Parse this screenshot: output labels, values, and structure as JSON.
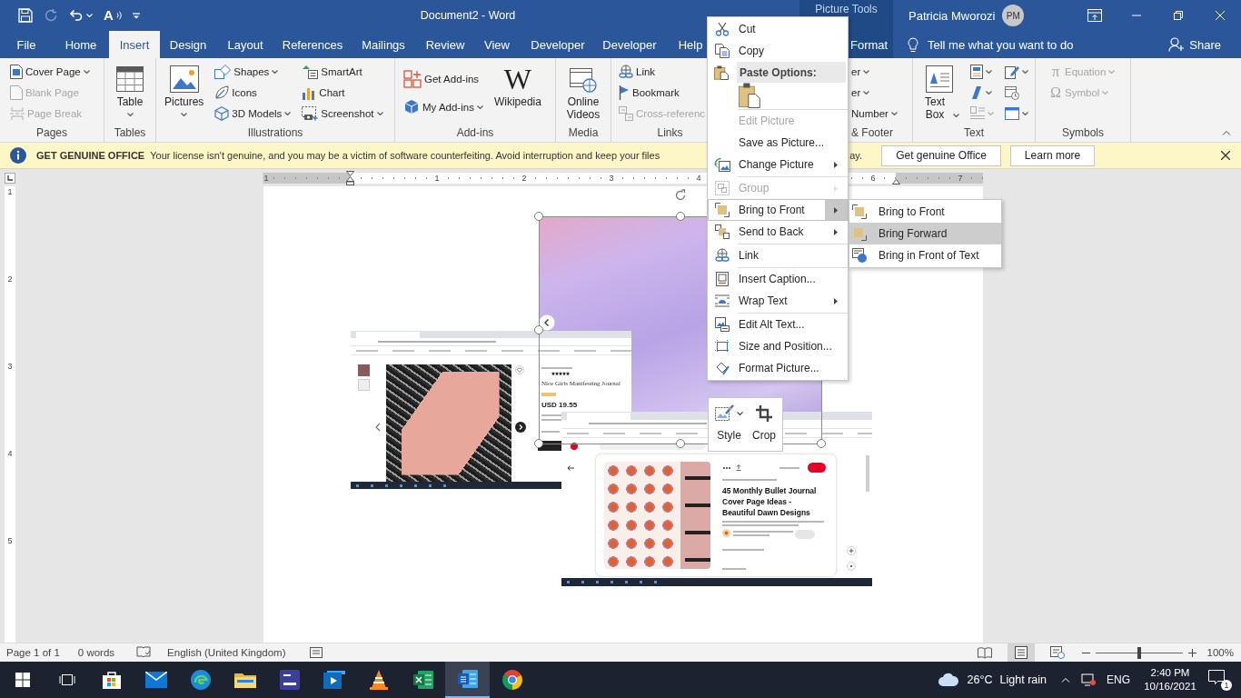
{
  "title_bar": {
    "quick_access": [
      {
        "kind": "save",
        "disabled": false,
        "dropdown": false
      },
      {
        "kind": "autosave",
        "disabled": true,
        "dropdown": false
      },
      {
        "kind": "undo",
        "disabled": false,
        "dropdown": true
      },
      {
        "kind": "read-aloud",
        "glyph": "A",
        "disabled": false,
        "dropdown": false
      },
      {
        "kind": "customize",
        "disabled": false,
        "dropdown": false
      }
    ],
    "title": "Document2 - Word",
    "contextual_header": "Picture Tools",
    "user": {
      "name": "Patricia Mworozi",
      "initials": "PM"
    }
  },
  "tabs": [
    {
      "label": "File",
      "selected": false,
      "contextual": false
    },
    {
      "label": "Home",
      "selected": false,
      "contextual": false
    },
    {
      "label": "Insert",
      "selected": true,
      "contextual": false
    },
    {
      "label": "Design",
      "selected": false,
      "contextual": false
    },
    {
      "label": "Layout",
      "selected": false,
      "contextual": false
    },
    {
      "label": "References",
      "selected": false,
      "contextual": false
    },
    {
      "label": "Mailings",
      "selected": false,
      "contextual": false
    },
    {
      "label": "Review",
      "selected": false,
      "contextual": false
    },
    {
      "label": "View",
      "selected": false,
      "contextual": false
    },
    {
      "label": "Developer",
      "selected": false,
      "contextual": false
    },
    {
      "label": "Developer",
      "selected": false,
      "contextual": false
    },
    {
      "label": "Help",
      "selected": false,
      "contextual": false
    },
    {
      "label": "Format",
      "selected": false,
      "contextual": true
    }
  ],
  "tell_me": {
    "placeholder": "Tell me what you want to do"
  },
  "share": {
    "label": "Share"
  },
  "ribbon": {
    "groups": [
      {
        "label": "Pages",
        "commands": [
          {
            "kind": "small",
            "label": "Cover Page",
            "dropdown": true,
            "disabled": false
          },
          {
            "kind": "small",
            "label": "Blank Page",
            "dropdown": false,
            "disabled": true
          },
          {
            "kind": "small",
            "label": "Page Break",
            "dropdown": false,
            "disabled": true
          }
        ]
      },
      {
        "label": "Tables",
        "commands": [
          {
            "kind": "large",
            "label": "Table",
            "dropdown": true,
            "disabled": false
          }
        ]
      },
      {
        "label": "Illustrations",
        "commands": [
          {
            "kind": "large",
            "label": "Pictures",
            "dropdown": true,
            "disabled": false
          },
          {
            "kind": "small",
            "label": "Shapes",
            "dropdown": true,
            "disabled": false
          },
          {
            "kind": "small",
            "label": "Icons",
            "dropdown": false,
            "disabled": false
          },
          {
            "kind": "small",
            "label": "3D Models",
            "dropdown": true,
            "disabled": false
          },
          {
            "kind": "small",
            "label": "SmartArt",
            "dropdown": false,
            "disabled": false
          },
          {
            "kind": "small",
            "label": "Chart",
            "dropdown": false,
            "disabled": false
          },
          {
            "kind": "small",
            "label": "Screenshot",
            "dropdown": true,
            "disabled": false
          }
        ]
      },
      {
        "label": "Add-ins",
        "commands": [
          {
            "kind": "small",
            "label": "Get Add-ins",
            "dropdown": false,
            "disabled": false
          },
          {
            "kind": "small",
            "label": "My Add-ins",
            "dropdown": true,
            "disabled": false
          },
          {
            "kind": "large",
            "label": "Wikipedia",
            "glyph": "W",
            "dropdown": false,
            "disabled": false
          }
        ]
      },
      {
        "label": "Media",
        "commands": [
          {
            "kind": "large",
            "label": "Online Videos",
            "dropdown": false,
            "disabled": false
          }
        ]
      },
      {
        "label": "Links",
        "commands": [
          {
            "kind": "small",
            "label": "Link",
            "dropdown": false,
            "disabled": false
          },
          {
            "kind": "small",
            "label": "Bookmark",
            "dropdown": false,
            "disabled": false
          },
          {
            "kind": "small",
            "label": "Cross-referenc",
            "dropdown": false,
            "disabled": true
          }
        ]
      },
      {
        "label": "& Footer",
        "commands": [
          {
            "kind": "small",
            "label": "er",
            "dropdown": true,
            "disabled": false
          },
          {
            "kind": "small",
            "label": "er",
            "dropdown": true,
            "disabled": false
          },
          {
            "kind": "small",
            "label": "Number",
            "dropdown": true,
            "disabled": false
          }
        ]
      },
      {
        "label": "Text",
        "commands": [
          {
            "kind": "large",
            "label": "Text Box",
            "dropdown": true,
            "disabled": false
          },
          {
            "kind": "icon",
            "dropdown": true,
            "disabled": false
          },
          {
            "kind": "icon",
            "dropdown": true,
            "disabled": false
          },
          {
            "kind": "icon",
            "dropdown": true,
            "disabled": true
          },
          {
            "kind": "icon",
            "dropdown": true,
            "disabled": false
          },
          {
            "kind": "icon",
            "dropdown": false,
            "disabled": false
          },
          {
            "kind": "icon",
            "dropdown": true,
            "disabled": false
          }
        ]
      },
      {
        "label": "Symbols",
        "commands": [
          {
            "kind": "small",
            "label": "Equation",
            "glyph": "π",
            "dropdown": true,
            "disabled": true
          },
          {
            "kind": "small",
            "label": "Symbol",
            "glyph": "Ω",
            "dropdown": true,
            "disabled": true
          }
        ]
      }
    ]
  },
  "message_bar": {
    "title": "GET GENUINE OFFICE",
    "message": "Your license isn't genuine, and you may be a victim of software counterfeiting. Avoid interruption and keep your files",
    "message_tail": "ay.",
    "buttons": [
      "Get genuine Office",
      "Learn more"
    ]
  },
  "ruler": {
    "horizontal": [
      "1",
      "1",
      "2",
      "3",
      "4",
      "6",
      "7"
    ],
    "vertical": [
      "1",
      "2",
      "3",
      "4",
      "5"
    ]
  },
  "document": {
    "pictures": [
      {
        "kind": "photo",
        "selected": true
      },
      {
        "kind": "shop-screenshot",
        "title": "Nice Girls Manifesting Journal",
        "price": "USD 19.55",
        "selected": false
      },
      {
        "kind": "pin-screenshot",
        "title": "45 Monthly Bullet Journal Cover Page Ideas - Beautiful Dawn Designs",
        "selected": false
      }
    ]
  },
  "context_menu": {
    "items": [
      {
        "kind": "item",
        "label": "Cut",
        "disabled": false,
        "submenu": false,
        "selected": false
      },
      {
        "kind": "item",
        "label": "Copy",
        "disabled": false,
        "submenu": false,
        "selected": false
      },
      {
        "kind": "header",
        "label": "Paste Options:"
      },
      {
        "kind": "paste-option"
      },
      {
        "kind": "separator"
      },
      {
        "kind": "item",
        "label": "Edit Picture",
        "disabled": true,
        "submenu": false,
        "selected": false
      },
      {
        "kind": "item",
        "label": "Save as Picture...",
        "disabled": false,
        "submenu": false,
        "selected": false
      },
      {
        "kind": "item",
        "label": "Change Picture",
        "disabled": false,
        "submenu": true,
        "selected": false
      },
      {
        "kind": "separator"
      },
      {
        "kind": "item",
        "label": "Group",
        "disabled": true,
        "submenu": true,
        "selected": false
      },
      {
        "kind": "item",
        "label": "Bring to Front",
        "disabled": false,
        "submenu": true,
        "selected": true
      },
      {
        "kind": "item",
        "label": "Send to Back",
        "disabled": false,
        "submenu": true,
        "selected": false
      },
      {
        "kind": "separator"
      },
      {
        "kind": "item",
        "label": "Link",
        "disabled": false,
        "submenu": false,
        "selected": false
      },
      {
        "kind": "separator"
      },
      {
        "kind": "item",
        "label": "Insert Caption...",
        "disabled": false,
        "submenu": false,
        "selected": false
      },
      {
        "kind": "item",
        "label": "Wrap Text",
        "disabled": false,
        "submenu": true,
        "selected": false
      },
      {
        "kind": "separator"
      },
      {
        "kind": "item",
        "label": "Edit Alt Text...",
        "disabled": false,
        "submenu": false,
        "selected": false
      },
      {
        "kind": "item",
        "label": "Size and Position...",
        "disabled": false,
        "submenu": false,
        "selected": false
      },
      {
        "kind": "item",
        "label": "Format Picture...",
        "disabled": false,
        "submenu": false,
        "selected": false
      }
    ]
  },
  "submenu": {
    "items": [
      {
        "label": "Bring to Front",
        "selected": false
      },
      {
        "label": "Bring Forward",
        "selected": true
      },
      {
        "label": "Bring in Front of Text",
        "selected": false
      }
    ]
  },
  "mini_toolbar": {
    "buttons": [
      {
        "label": "Style",
        "dropdown": true
      },
      {
        "label": "Crop",
        "dropdown": false
      }
    ]
  },
  "status_bar": {
    "page": "Page 1 of 1",
    "words": "0 words",
    "language": "English (United Kingdom)",
    "views": [
      {
        "kind": "read",
        "selected": false
      },
      {
        "kind": "print",
        "selected": true
      },
      {
        "kind": "web",
        "selected": false
      }
    ],
    "zoom": {
      "level": 0.5,
      "reading": "100%"
    }
  },
  "taskbar": {
    "apps": [
      {
        "kind": "start",
        "selected": false
      },
      {
        "kind": "task-view",
        "selected": false
      },
      {
        "kind": "store",
        "selected": false
      },
      {
        "kind": "mail",
        "selected": false
      },
      {
        "kind": "edge",
        "selected": false
      },
      {
        "kind": "explorer",
        "selected": false
      },
      {
        "kind": "tile",
        "selected": false
      },
      {
        "kind": "media",
        "selected": false
      },
      {
        "kind": "vlc",
        "selected": false
      },
      {
        "kind": "excel",
        "selected": false
      },
      {
        "kind": "word",
        "selected": true
      },
      {
        "kind": "chrome",
        "selected": false
      }
    ],
    "weather": {
      "temperature": "26°C",
      "condition": "Light rain"
    },
    "language": "ENG",
    "time": "2:40 PM",
    "date": "10/16/2021",
    "notifications": "1"
  }
}
